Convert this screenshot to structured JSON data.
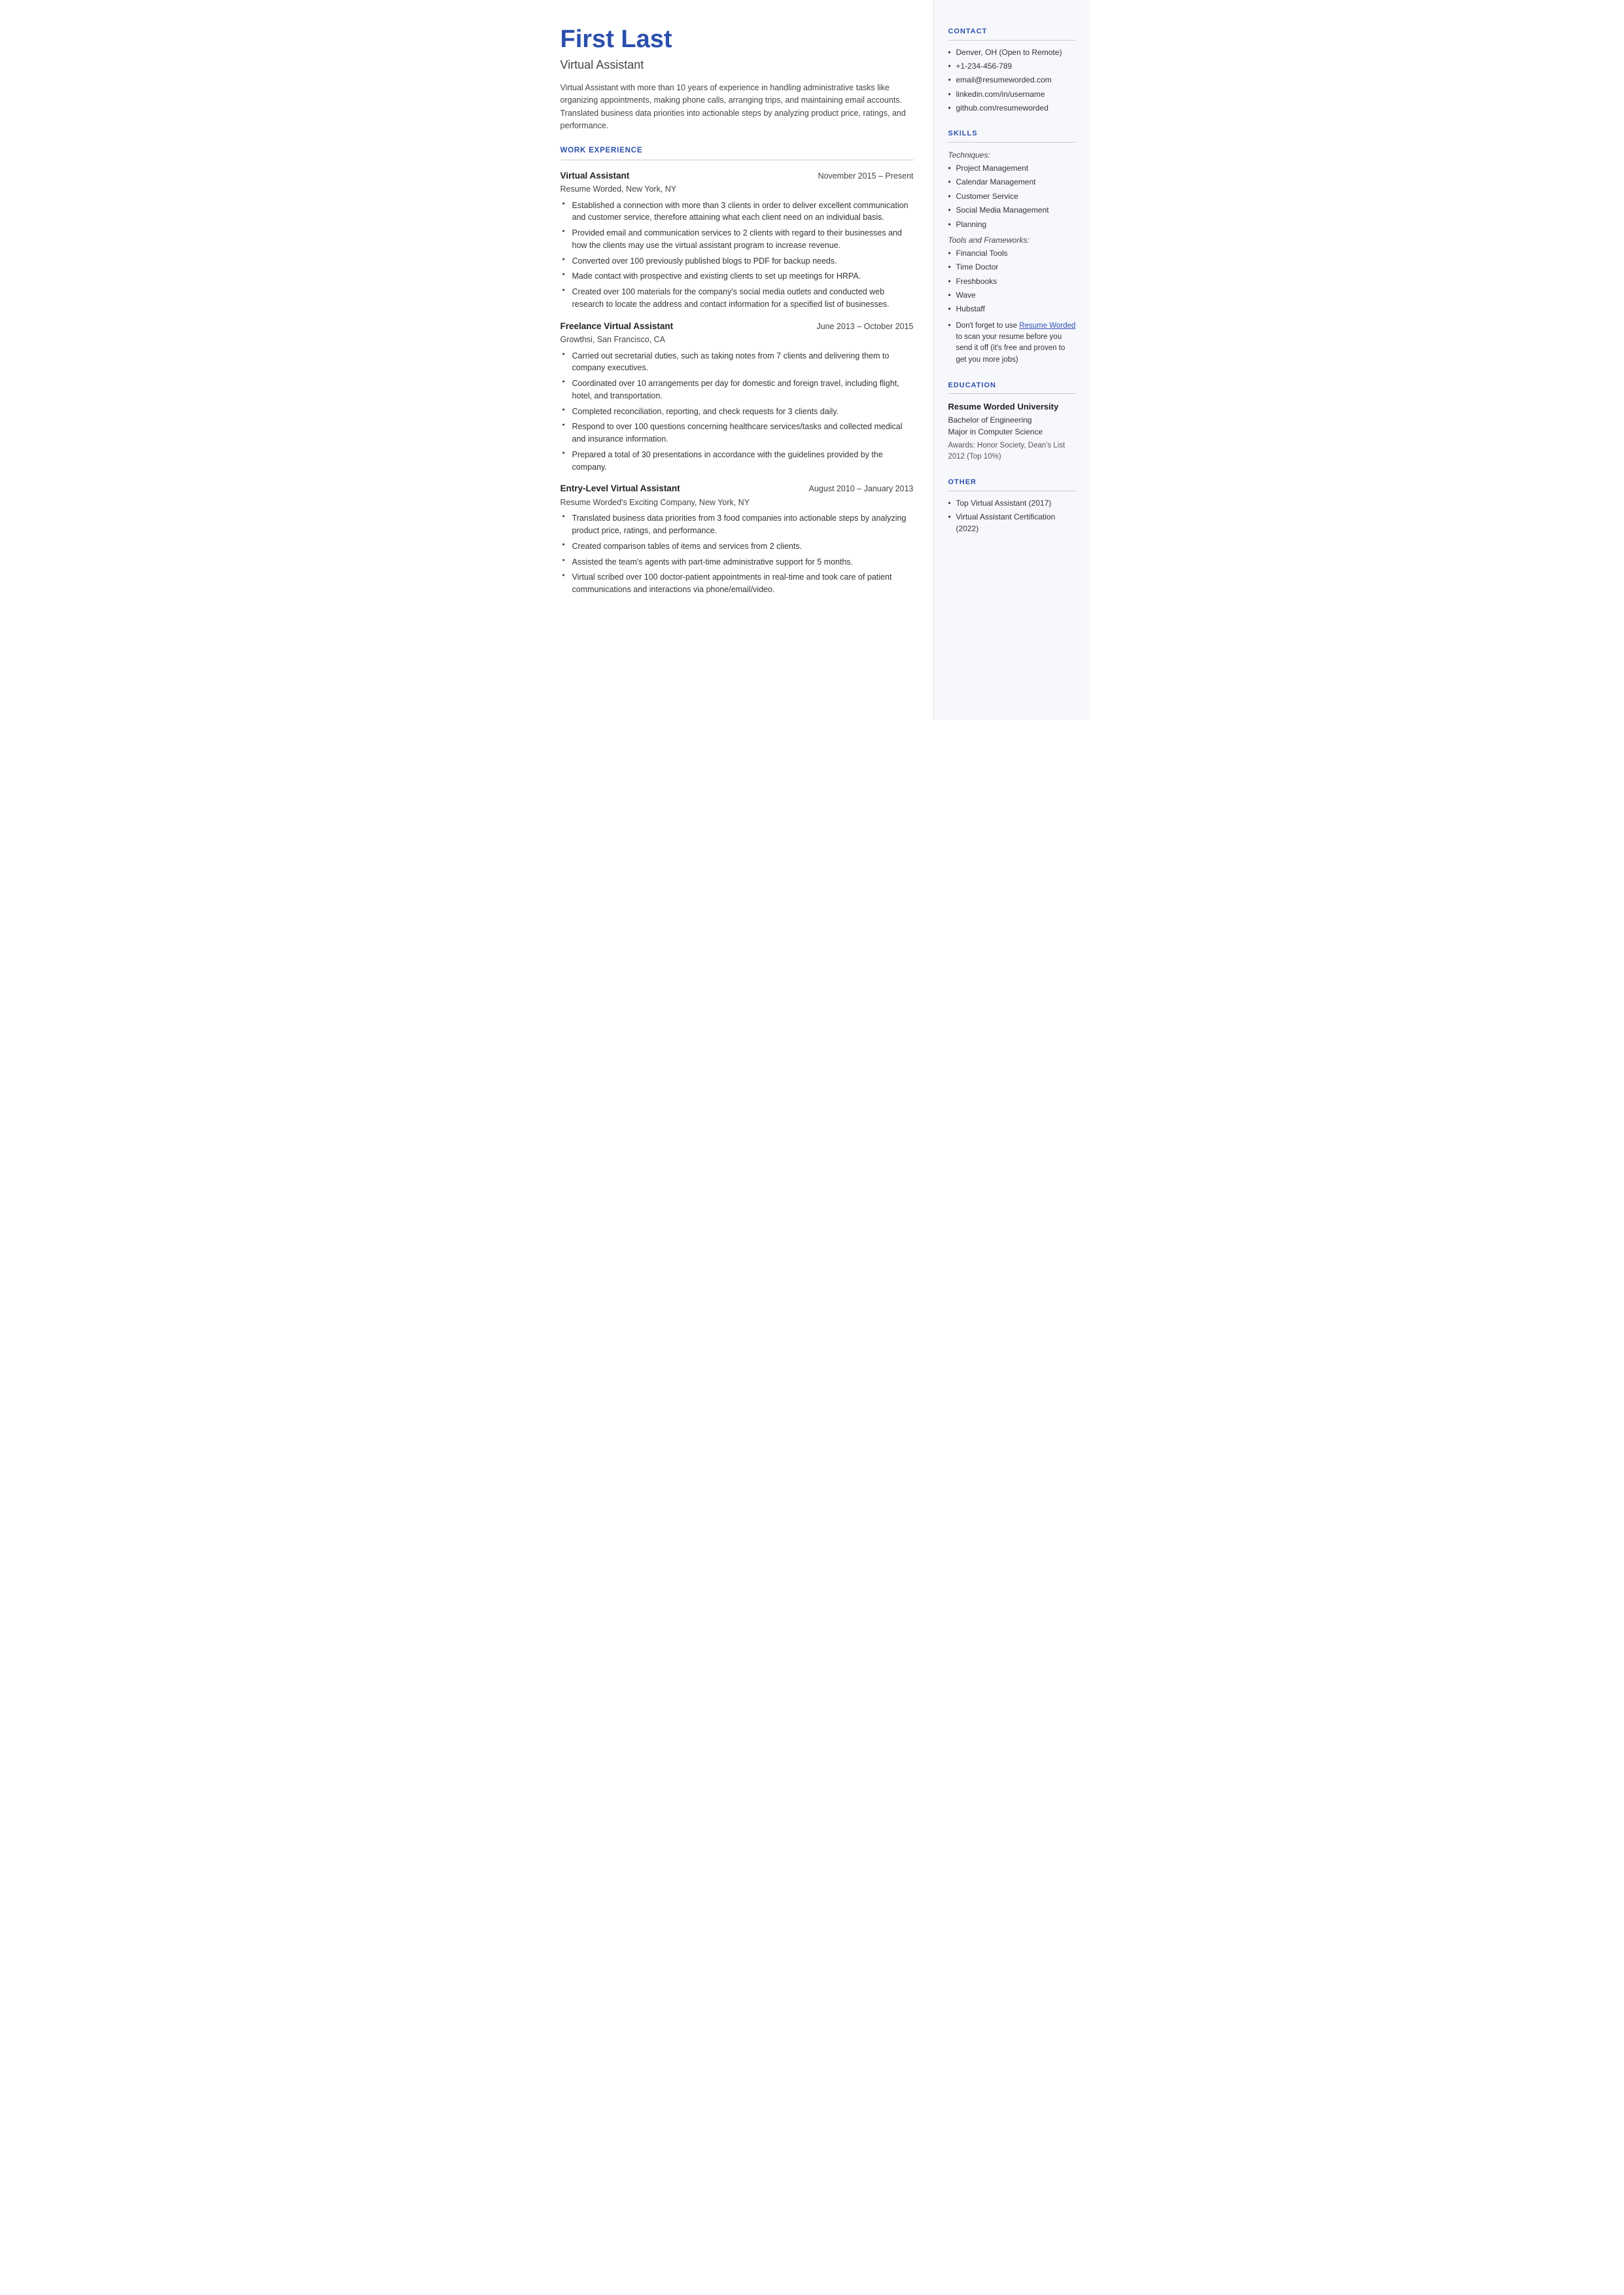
{
  "header": {
    "name": "First Last",
    "title": "Virtual Assistant",
    "summary": "Virtual Assistant with more than 10 years of experience in handling administrative tasks like organizing appointments, making phone calls, arranging trips, and maintaining email accounts. Translated business data priorities into actionable steps by analyzing product price, ratings, and performance."
  },
  "work_experience": {
    "section_title": "WORK EXPERIENCE",
    "jobs": [
      {
        "title": "Virtual Assistant",
        "dates": "November 2015 – Present",
        "company": "Resume Worded, New York, NY",
        "bullets": [
          "Established a connection with more than 3 clients in order to deliver excellent communication and customer service, therefore attaining what each client need on an individual basis.",
          "Provided email and communication services to 2 clients with regard to their businesses and how the clients may use the virtual assistant program to increase revenue.",
          "Converted over 100 previously published blogs to PDF for backup needs.",
          "Made contact with prospective and existing clients to set up meetings for HRPA.",
          "Created over 100 materials for the company's social media outlets and conducted web research to locate the address and contact information for a specified list of businesses."
        ]
      },
      {
        "title": "Freelance Virtual Assistant",
        "dates": "June 2013 – October 2015",
        "company": "Growthsi, San Francisco, CA",
        "bullets": [
          "Carried out secretarial duties, such as taking notes from 7 clients and delivering them to company executives.",
          "Coordinated over 10 arrangements per day for domestic and foreign travel, including flight, hotel, and transportation.",
          "Completed reconciliation, reporting, and check requests for 3 clients daily.",
          "Respond to over 100 questions concerning healthcare services/tasks and collected medical and insurance information.",
          "Prepared a total of 30 presentations in accordance with the guidelines provided by the company."
        ]
      },
      {
        "title": "Entry-Level Virtual Assistant",
        "dates": "August 2010 – January 2013",
        "company": "Resume Worded's Exciting Company, New York, NY",
        "bullets": [
          "Translated business data priorities from 3 food companies into actionable steps by analyzing product price, ratings, and performance.",
          "Created comparison tables of items and services from 2 clients.",
          "Assisted the team's agents with part-time administrative support for 5 months.",
          "Virtual scribed over 100 doctor-patient appointments in real-time and took care of patient communications and interactions via phone/email/video."
        ]
      }
    ]
  },
  "contact": {
    "section_title": "CONTACT",
    "items": [
      "Denver, OH (Open to Remote)",
      "+1-234-456-789",
      "email@resumeworded.com",
      "linkedin.com/in/username",
      "github.com/resumeworded"
    ]
  },
  "skills": {
    "section_title": "SKILLS",
    "techniques_label": "Techniques:",
    "techniques": [
      "Project Management",
      "Calendar Management",
      "Customer Service",
      "Social Media Management",
      "Planning"
    ],
    "tools_label": "Tools and Frameworks:",
    "tools": [
      "Financial Tools",
      "Time Doctor",
      "Freshbooks",
      "Wave",
      "Hubstaff"
    ],
    "note_prefix": "Don't forget to use ",
    "note_link_text": "Resume Worded",
    "note_link_url": "#",
    "note_suffix": " to scan your resume before you send it off (it's free and proven to get you more jobs)"
  },
  "education": {
    "section_title": "EDUCATION",
    "school": "Resume Worded University",
    "degree": "Bachelor of Engineering",
    "major": "Major in Computer Science",
    "awards": "Awards: Honor Society, Dean's List 2012 (Top 10%)"
  },
  "other": {
    "section_title": "OTHER",
    "items": [
      "Top Virtual Assistant (2017)",
      "Virtual Assistant Certification (2022)"
    ]
  }
}
